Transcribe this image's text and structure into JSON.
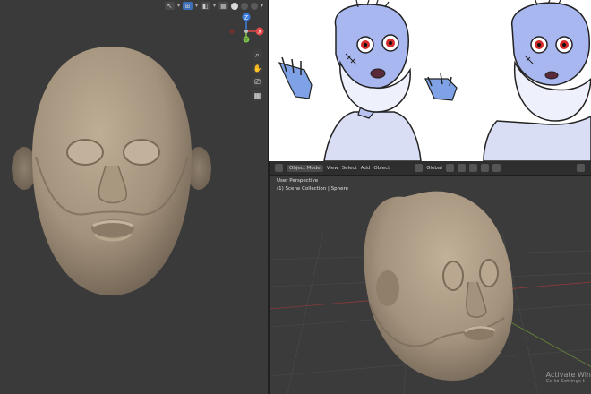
{
  "left_viewport": {
    "header_icons": [
      "cursor-icon",
      "overlay-icon",
      "shading-icon",
      "solid-shading-icon",
      "material-shading-icon"
    ]
  },
  "gizmo": {
    "z_label": "Z",
    "x_label": "X",
    "y_label": "Y"
  },
  "right_viewport": {
    "toolbar": {
      "mode": "Object Mode",
      "menus": [
        "View",
        "Select",
        "Add",
        "Object"
      ],
      "orientation": "Global"
    },
    "info": {
      "perspective": "User Perspective",
      "collection": "(1) Scene Collection | Sphere"
    }
  },
  "watermark": {
    "title": "Activate Win",
    "subtitle": "Go to Settings t"
  },
  "colors": {
    "viewport_bg": "#3a3a3a",
    "header_bg": "#2e2e2e",
    "sculpt_clay": "#a3927c",
    "x_axis": "#e04a4a",
    "y_axis": "#7fc24a",
    "z_axis": "#3c7ddd",
    "reference_bg": "#ffffff",
    "character_skin": "#a9b7f0",
    "character_eyes": "#d42a2a"
  }
}
